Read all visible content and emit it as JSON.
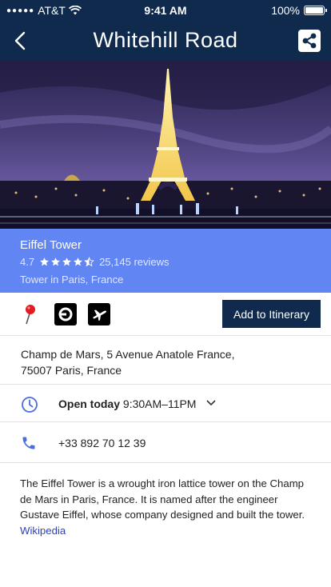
{
  "status_bar": {
    "carrier": "AT&T",
    "time": "9:41 AM",
    "battery": "100%"
  },
  "nav": {
    "title": "Whitehill Road"
  },
  "place": {
    "name": "Eiffel Tower",
    "rating": "4.7",
    "stars_filled": 4.5,
    "reviews": "25,145 reviews",
    "category": "Tower in Paris, France"
  },
  "actions": {
    "add_itinerary_label": "Add to Itinerary"
  },
  "address": {
    "line1": "Champ de Mars, 5 Avenue Anatole France,",
    "line2": "75007 Paris, France"
  },
  "hours": {
    "status": "Open today",
    "range": "9:30AM–11PM"
  },
  "phone": {
    "number": "+33 892 70 12 39"
  },
  "description": {
    "text": "The Eiffel Tower is a wrought iron lattice tower on the Champ de Mars in Paris, France. It is named after the engineer Gustave Eiffel, whose company designed and built the tower.",
    "link_label": "Wikipedia"
  },
  "colors": {
    "nav_bg": "#0f2a4d",
    "card_bg": "#6185f2",
    "icon_blue": "#4a6fdc",
    "link": "#2a3fb8"
  },
  "icons": {
    "back": "chevron-left-icon",
    "share": "share-icon",
    "pin": "map-pin-icon",
    "uber": "uber-icon",
    "flight": "airplane-icon",
    "clock": "clock-icon",
    "phone": "phone-icon",
    "expand": "chevron-down-icon"
  }
}
